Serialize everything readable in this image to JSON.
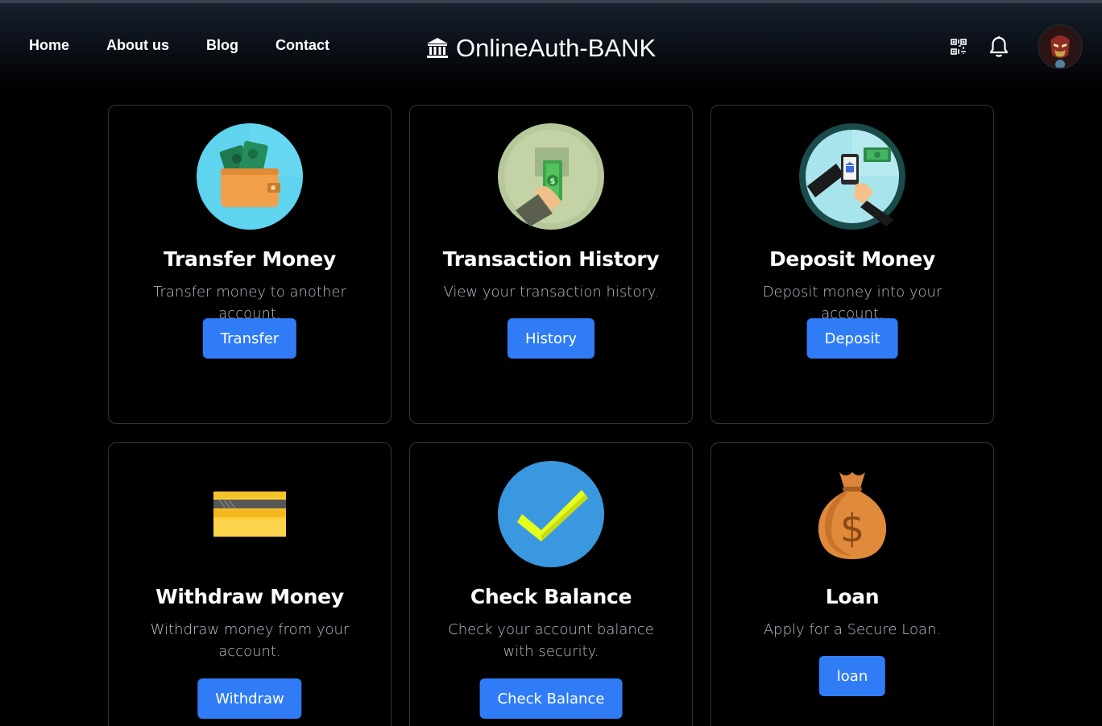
{
  "nav": {
    "items": [
      {
        "label": "Home"
      },
      {
        "label": "About us"
      },
      {
        "label": "Blog"
      },
      {
        "label": "Contact"
      }
    ]
  },
  "brand": {
    "title": "OnlineAuth-BANK",
    "icon": "bank-icon"
  },
  "header_icons": {
    "qr": "qr-code-icon",
    "bell": "bell-icon",
    "avatar": "user-avatar"
  },
  "cards": [
    {
      "title": "Transfer Money",
      "description": "Transfer money to another account.",
      "button": "Transfer",
      "icon": "wallet-money-icon"
    },
    {
      "title": "Transaction History",
      "description": "View your transaction history.",
      "button": "History",
      "icon": "hand-cash-icon"
    },
    {
      "title": "Deposit Money",
      "description": "Deposit money into your account.",
      "button": "Deposit",
      "icon": "mobile-deposit-icon"
    },
    {
      "title": "Withdraw Money",
      "description": "Withdraw money from your account.",
      "button": "Withdraw",
      "icon": "credit-card-icon"
    },
    {
      "title": "Check Balance",
      "description": "Check your account balance with security.",
      "button": "Check Balance",
      "icon": "check-mark-icon"
    },
    {
      "title": "Loan",
      "description": "Apply for a Secure Loan.",
      "button": "loan",
      "icon": "money-bag-icon"
    }
  ],
  "colors": {
    "accent": "#2f7cf6",
    "background": "#000000",
    "card_border": "#2f3540",
    "muted_text": "#b8bec8"
  }
}
